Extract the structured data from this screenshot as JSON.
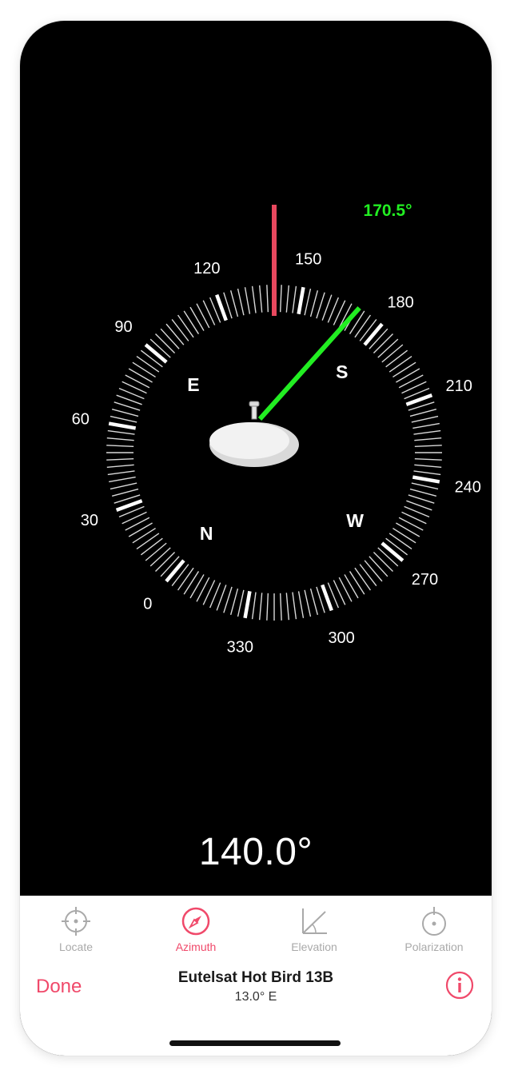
{
  "compass": {
    "dial_labels": [
      "0",
      "30",
      "60",
      "90",
      "120",
      "150",
      "180",
      "210",
      "240",
      "270",
      "300",
      "330"
    ],
    "cardinals": [
      "N",
      "E",
      "S",
      "W"
    ],
    "target_readout": "170.5°",
    "target_azimuth": 170.5,
    "current_heading_value": 140.0,
    "heading_readout": "140.0°",
    "colors": {
      "target_needle": "#22ee22",
      "heading_marker": "#e8485e",
      "ticks": "#ffffff"
    }
  },
  "tabs": [
    {
      "label": "Locate",
      "icon": "crosshair-icon",
      "active": false
    },
    {
      "label": "Azimuth",
      "icon": "compass-icon",
      "active": true
    },
    {
      "label": "Elevation",
      "icon": "angle-icon",
      "active": false
    },
    {
      "label": "Polarization",
      "icon": "dial-icon",
      "active": false
    }
  ],
  "footer": {
    "done_label": "Done",
    "satellite_name": "Eutelsat Hot Bird 13B",
    "satellite_position": "13.0° E"
  },
  "accent_color": "#f0496a"
}
